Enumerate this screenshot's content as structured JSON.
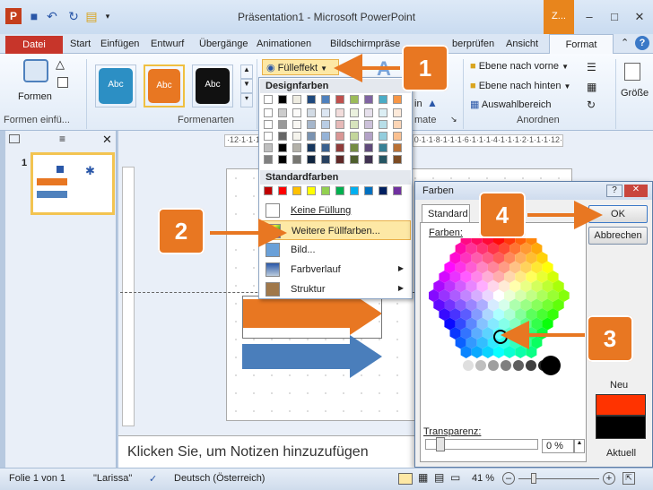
{
  "titlebar": {
    "title": "Präsentation1 - Microsoft PowerPoint",
    "ctx_group": "Z...",
    "app_icon": "P"
  },
  "tabs": [
    "Datei",
    "Start",
    "Einfügen",
    "Entwurf",
    "Übergänge",
    "Animationen",
    "Bildschirmpräsentation",
    "Überprüfen",
    "Ansicht",
    "Format"
  ],
  "tab_visible": {
    "bildschirm": "Bildschirmpräse",
    "ueberpruefen": "berprüfen"
  },
  "ribbon": {
    "formen_label": "Formen",
    "group_formen": "Formen einfü...",
    "group_formenarten": "Formenarten",
    "group_formate": "mate",
    "group_anordnen": "Anordnen",
    "style_label": "Abc",
    "fuelleffekt": "Fülleffekt",
    "ebene_vorne": "Ebene nach vorne",
    "ebene_hinten": "Ebene nach hinten",
    "auswahlbereich": "Auswahlbereich",
    "groesse": "Größe",
    "partial_in": "in"
  },
  "dropdown": {
    "designfarben": "Designfarben",
    "standardfarben": "Standardfarben",
    "keine_fuellung": "Keine Füllung",
    "weitere": "Weitere Füllfarben...",
    "bild": "Bild...",
    "farbverlauf": "Farbverlauf",
    "struktur": "Struktur",
    "design_colors": [
      "#ffffff",
      "#000000",
      "#eeece1",
      "#1f497d",
      "#4f81bd",
      "#c0504d",
      "#9bbb59",
      "#8064a2",
      "#4bacc6",
      "#f79646"
    ],
    "standard_colors": [
      "#c00000",
      "#ff0000",
      "#ffc000",
      "#ffff00",
      "#92d050",
      "#00b050",
      "#00b0f0",
      "#0070c0",
      "#002060",
      "#7030a0"
    ]
  },
  "ruler": {
    "h": "·12·1·1·1·2·1·1·1·4·1·1·1·6·1·1·1·8·1·1·10·1·12·"
  },
  "slide_thumb_number": "1",
  "notes": "Klicken Sie, um Notizen hinzuzufügen",
  "dialog": {
    "title": "Farben",
    "tab": "Standard",
    "farben_label": "Farben:",
    "ok": "OK",
    "abbrechen": "Abbrechen",
    "neu": "Neu",
    "aktuell": "Aktuell",
    "transparenz": "Transparenz:",
    "transparenz_value": "0 %",
    "neu_color": "#ff3300",
    "aktuell_color": "#000000"
  },
  "callouts": [
    "1",
    "2",
    "3",
    "4"
  ],
  "statusbar": {
    "folie": "Folie 1 von 1",
    "theme": "\"Larissa\"",
    "lang": "Deutsch (Österreich)",
    "zoom": "41 %"
  },
  "accent": {
    "orange": "#e87722",
    "ribbon_tab_red": "#c7352a"
  }
}
